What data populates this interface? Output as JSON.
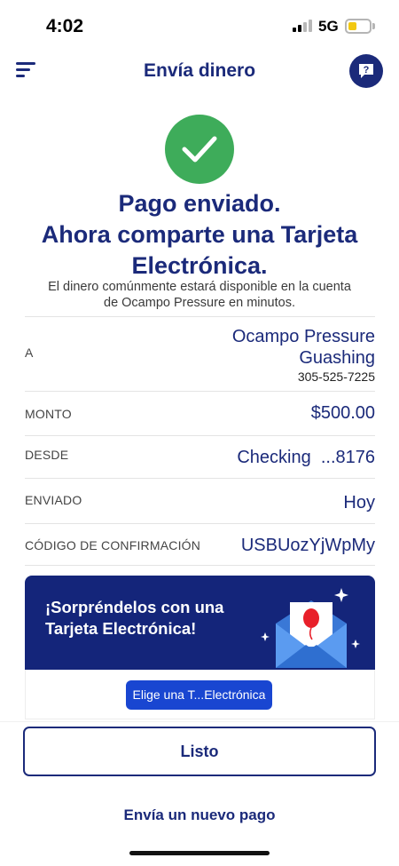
{
  "status_bar": {
    "time": "4:02",
    "network": "5G",
    "icons": [
      "signal-icon",
      "battery-icon"
    ]
  },
  "header": {
    "title": "Envía dinero",
    "menu_icon": "menu-icon",
    "help_icon": "help-icon"
  },
  "success": {
    "icon": "checkmark-icon",
    "headline_line1": "Pago enviado.",
    "headline_line2": "Ahora comparte una Tarjeta",
    "headline_line3": "Electrónica.",
    "subtext_line1": "El dinero comúnmente estará disponible en la cuenta",
    "subtext_line2": "de Ocampo Pressure en minutos."
  },
  "details": {
    "recipient_label": "A",
    "recipient_name_line1": "Ocampo Pressure",
    "recipient_name_line2": "Guashing",
    "recipient_phone": "305-525-7225",
    "amount_label": "MONTO",
    "amount_value": "$500.00",
    "from_label": "DESDE",
    "from_value": "Checking  ...8176",
    "sent_label": "ENVIADO",
    "sent_value": "Hoy",
    "confirmation_label": "CÓDIGO DE CONFIRMACIÓN",
    "confirmation_value": "USBUozYjWpMy"
  },
  "ecard_promo": {
    "line1": "¡Sorpréndelos con una",
    "line2": "Tarjeta Electrónica!",
    "button_label": "Elige una T...Electrónica",
    "art_icon": "envelope-balloon-icon"
  },
  "actions": {
    "done_label": "Listo",
    "new_payment_label": "Envía un nuevo pago"
  },
  "colors": {
    "brand_navy": "#1b2a7a",
    "promo_bg": "#14257a",
    "button_blue": "#1946d1",
    "success_green": "#3eac5a",
    "balloon_red": "#e8202a"
  }
}
